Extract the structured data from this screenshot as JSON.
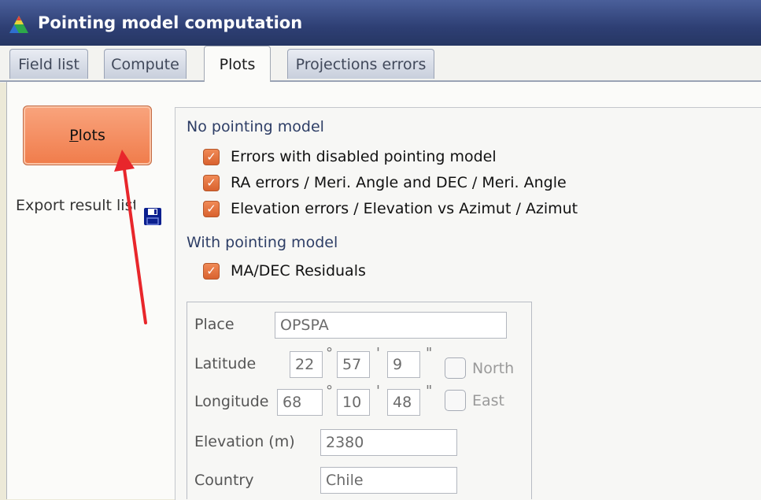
{
  "window": {
    "title": "Pointing model computation",
    "icon": "pyramid-app-icon"
  },
  "tabs": [
    {
      "label": "Field list",
      "active": false
    },
    {
      "label": "Compute",
      "active": false
    },
    {
      "label": "Plots",
      "active": true
    },
    {
      "label": "Projections errors",
      "active": false
    }
  ],
  "left": {
    "plots_button_underlined": "P",
    "plots_button_rest": "lots",
    "export_label": "Export result list",
    "save_icon": "floppy-disk-icon"
  },
  "options": {
    "no_model_heading": "No pointing model",
    "no_model_items": [
      {
        "label": "Errors with disabled pointing model",
        "checked": true
      },
      {
        "label": "RA errors / Meri. Angle and DEC / Meri. Angle",
        "checked": true
      },
      {
        "label": "Elevation errors / Elevation vs Azimut / Azimut",
        "checked": true
      }
    ],
    "with_model_heading": "With pointing model",
    "with_model_items": [
      {
        "label": "MA/DEC Residuals",
        "checked": true
      }
    ]
  },
  "location": {
    "place_label": "Place",
    "place_value": "OPSPA",
    "latitude_label": "Latitude",
    "latitude_deg": "22",
    "latitude_min": "57",
    "latitude_sec": "9",
    "north_label": "North",
    "north_checked": false,
    "longitude_label": "Longitude",
    "longitude_deg": "68",
    "longitude_min": "10",
    "longitude_sec": "48",
    "east_label": "East",
    "east_checked": false,
    "elevation_label": "Elevation (m)",
    "elevation_value": "2380",
    "country_label": "Country",
    "country_value": "Chile",
    "deg_symbol": "°",
    "min_symbol": "'",
    "sec_symbol": "\""
  },
  "colors": {
    "accent": "#f07c4b",
    "title_bar": "#2e3f74",
    "annotation_arrow": "#e8262b"
  }
}
